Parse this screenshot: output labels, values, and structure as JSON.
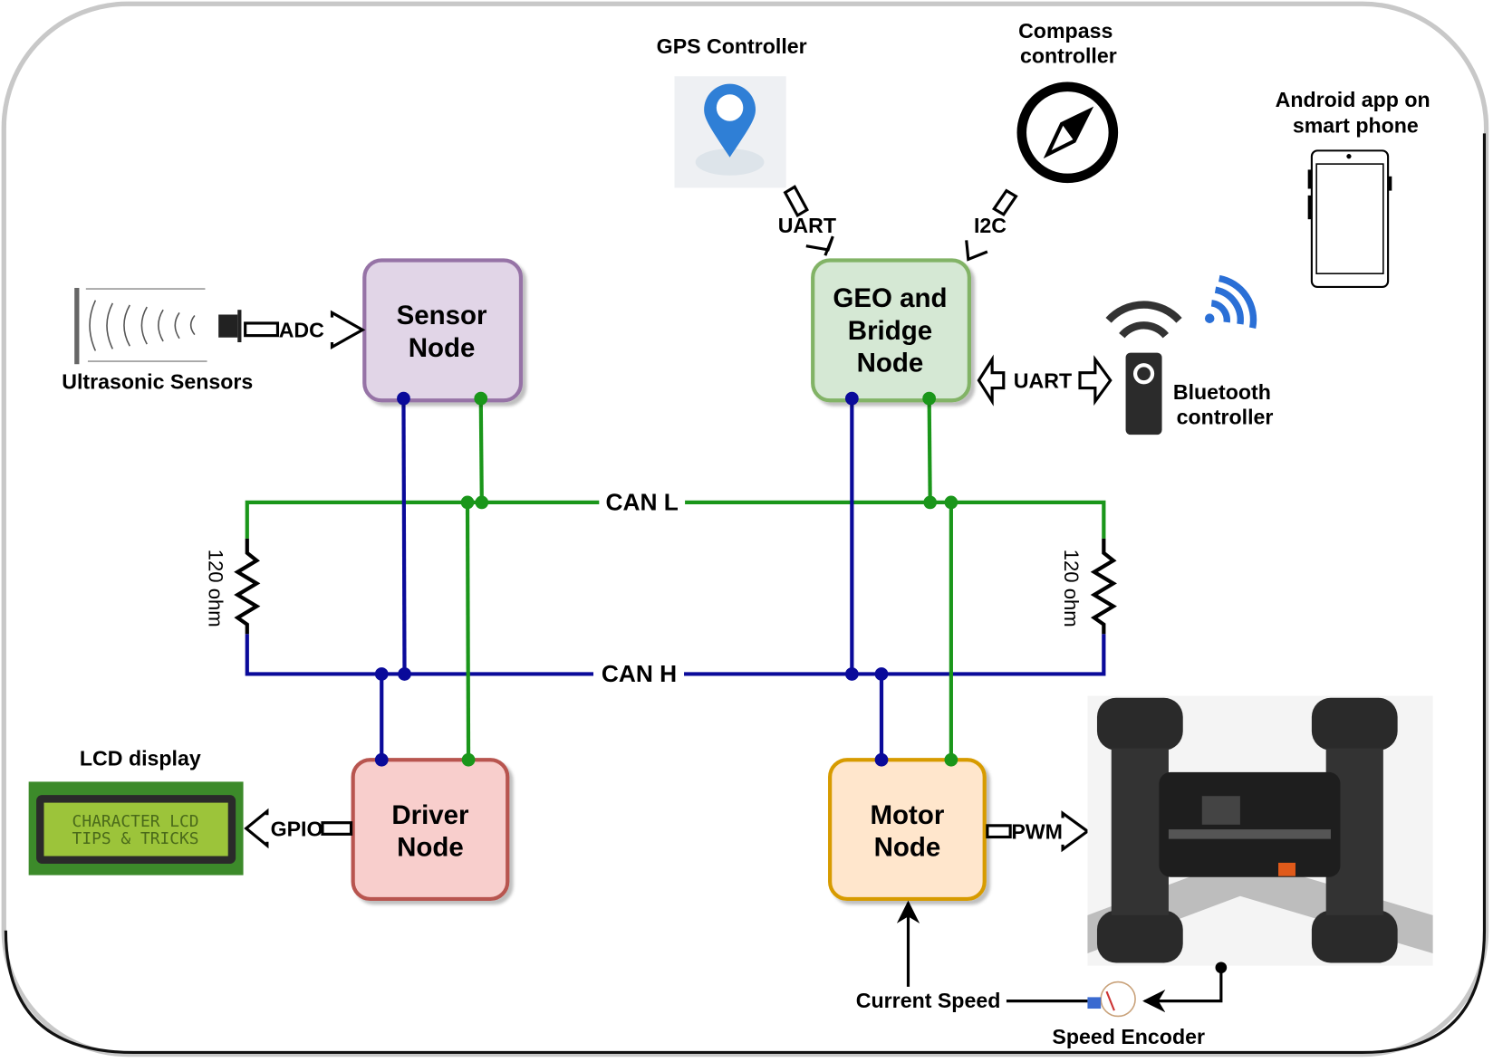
{
  "nodes": {
    "sensor": {
      "line1": "Sensor",
      "line2": "Node"
    },
    "geo": {
      "line1": "GEO and",
      "line2": "Bridge",
      "line3": "Node"
    },
    "driver": {
      "line1": "Driver",
      "line2": "Node"
    },
    "motor": {
      "line1": "Motor",
      "line2": "Node"
    }
  },
  "bus": {
    "can_l": "CAN L",
    "can_h": "CAN H",
    "resistor_left": "120 ohm",
    "resistor_right": "120 ohm"
  },
  "peripherals": {
    "gps": "GPS Controller",
    "compass_line1": "Compass",
    "compass_line2": "controller",
    "android_line1": "Android app on",
    "android_line2": "smart phone",
    "bluetooth_line1": "Bluetooth",
    "bluetooth_line2": "controller",
    "ultrasonic": "Ultrasonic Sensors",
    "lcd": "LCD display",
    "lcd_screen_line1": "CHARACTER LCD",
    "lcd_screen_line2": "TIPS & TRICKS",
    "current_speed": "Current Speed",
    "speed_encoder": "Speed Encoder"
  },
  "interfaces": {
    "adc": "ADC",
    "gpio": "GPIO",
    "pwm": "PWM",
    "uart_gps": "UART",
    "i2c": "I2C",
    "uart_bt": "UART"
  },
  "colors": {
    "can_l": "#1a961a",
    "can_h": "#0a0a9a",
    "sensor_fill": "#e1d5e7",
    "sensor_stroke": "#9673a6",
    "geo_fill": "#d5e8d4",
    "geo_stroke": "#82b366",
    "driver_fill": "#f8cecc",
    "driver_stroke": "#b85450",
    "motor_fill": "#ffe6cc",
    "motor_stroke": "#d79b00"
  }
}
